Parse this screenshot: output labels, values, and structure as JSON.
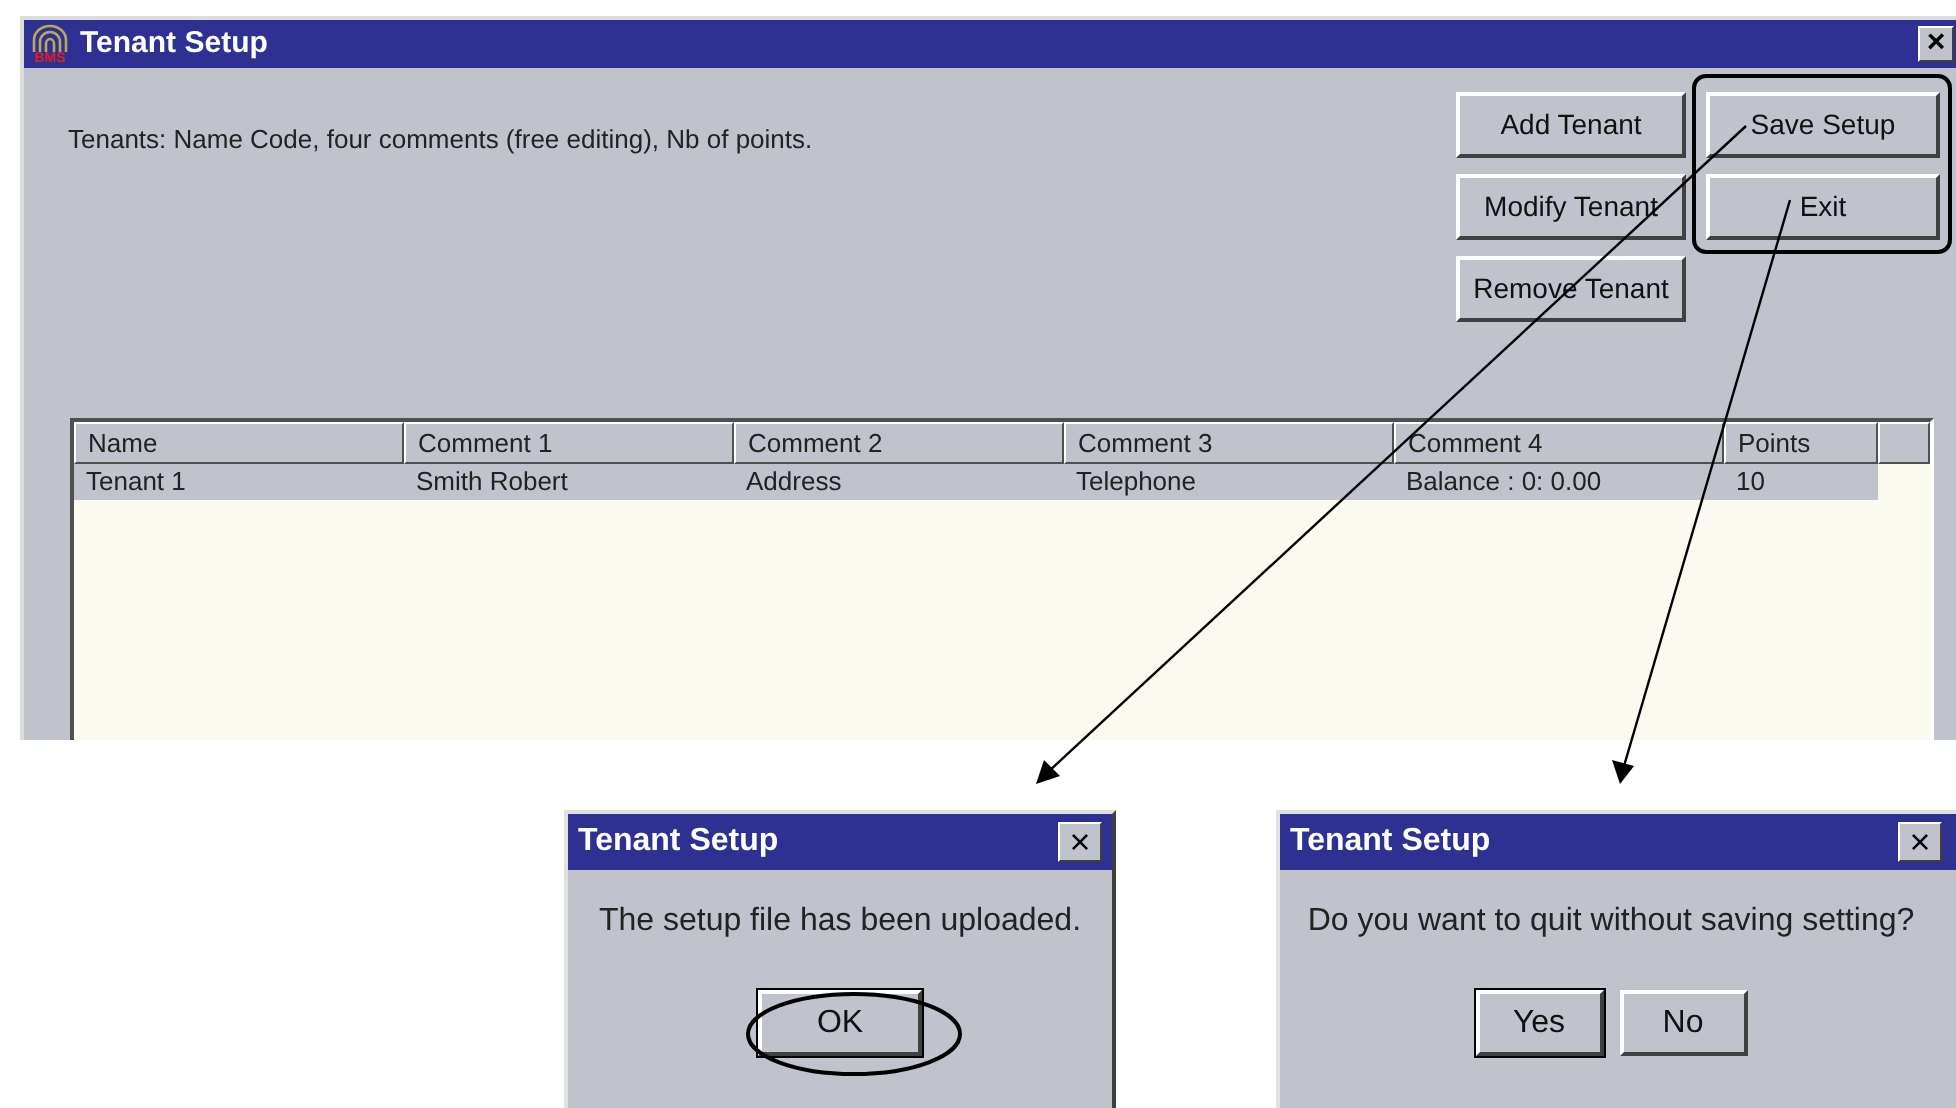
{
  "main_window": {
    "logo_text": "BMS",
    "title": "Tenant Setup",
    "close": "×",
    "description": "Tenants: Name Code, four comments (free editing), Nb of points.",
    "buttons_left": [
      "Add Tenant",
      "Modify Tenant",
      "Remove Tenant"
    ],
    "buttons_right": [
      "Save Setup",
      "Exit"
    ],
    "table": {
      "columns": [
        "Name",
        "Comment 1",
        "Comment 2",
        "Comment 3",
        "Comment 4",
        "Points"
      ],
      "rows": [
        {
          "cells": [
            "Tenant 1",
            "Smith Robert",
            "Address",
            "Telephone",
            "Balance : 0: 0.00",
            "10"
          ],
          "selected": true
        }
      ]
    }
  },
  "dialogs": [
    {
      "title": "Tenant Setup",
      "close": "×",
      "message": "The setup file has been uploaded.",
      "buttons": [
        "OK"
      ]
    },
    {
      "title": "Tenant Setup",
      "close": "×",
      "message": "Do you want to quit without saving setting?",
      "buttons": [
        "Yes",
        "No"
      ]
    }
  ]
}
